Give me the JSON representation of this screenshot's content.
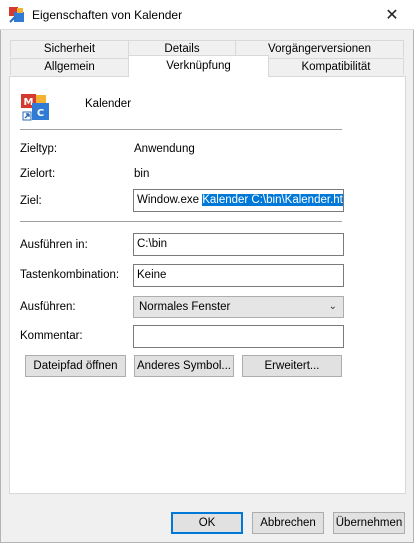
{
  "window": {
    "title": "Eigenschaften von Kalender",
    "close_label": "✕"
  },
  "tabs": {
    "row1": [
      "Sicherheit",
      "Details",
      "Vorgängerversionen"
    ],
    "row2": [
      "Allgemein",
      "Verknüpfung",
      "Kompatibilität"
    ],
    "active": "Verknüpfung"
  },
  "shortcut": {
    "name": "Kalender",
    "target_type_label": "Zieltyp:",
    "target_type_value": "Anwendung",
    "target_location_label": "Zielort:",
    "target_location_value": "bin",
    "target_label": "Ziel:",
    "target_value_plain": "Window.exe ",
    "target_value_selected": "Kalender C:\\bin\\Kalender.html",
    "start_in_label": "Ausführen in:",
    "start_in_value": "C:\\bin",
    "hotkey_label": "Tastenkombination:",
    "hotkey_value": "Keine",
    "run_label": "Ausführen:",
    "run_value": "Normales Fenster",
    "comment_label": "Kommentar:",
    "comment_value": ""
  },
  "panel_buttons": {
    "open_location": "Dateipfad öffnen",
    "change_icon": "Anderes Symbol...",
    "advanced": "Erweitert..."
  },
  "dialog_buttons": {
    "ok": "OK",
    "cancel": "Abbrechen",
    "apply": "Übernehmen"
  },
  "colors": {
    "selection": "#0078d7",
    "panel_bg": "#ffffff",
    "window_bg": "#f0f0f0"
  }
}
